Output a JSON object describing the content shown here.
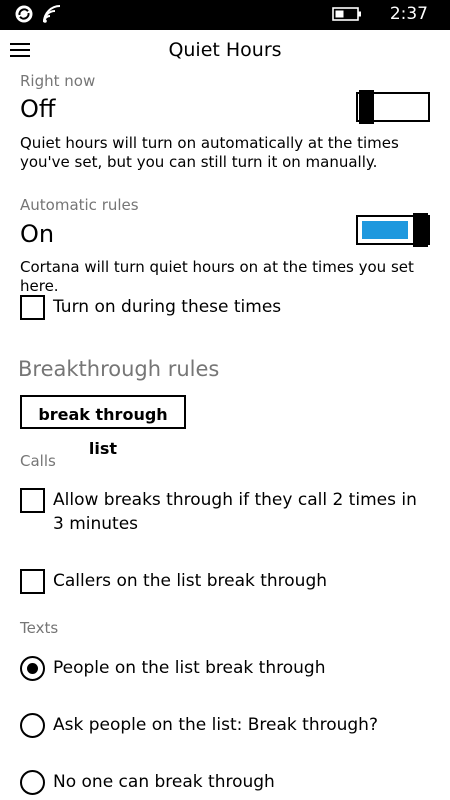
{
  "status_bar": {
    "time": "2:37",
    "icons": [
      "sync-icon",
      "wifi-icon",
      "battery-icon"
    ]
  },
  "header": {
    "title": "Quiet Hours",
    "menu_icon": "hamburger-menu-icon"
  },
  "right_now": {
    "label": "Right now",
    "value": "Off",
    "toggle_on": false,
    "description": "Quiet hours will turn on automatically at the times you've set, but you can still turn it on manually."
  },
  "automatic_rules": {
    "label": "Automatic rules",
    "value": "On",
    "toggle_on": true,
    "description": "Cortana will turn quiet hours on at the times you set here.",
    "checkbox": {
      "label": "Turn on during these times",
      "checked": false
    }
  },
  "breakthrough": {
    "title": "Breakthrough rules",
    "button_label": "break through list"
  },
  "calls": {
    "label": "Calls",
    "options": [
      {
        "label": "Allow breaks through if they call 2 times in 3 minutes",
        "checked": false
      },
      {
        "label": "Callers on the list break through",
        "checked": false
      }
    ]
  },
  "texts": {
    "label": "Texts",
    "options": [
      {
        "label": "People on the list break through",
        "selected": true
      },
      {
        "label": "Ask people on the list: Break through?",
        "selected": false
      },
      {
        "label": "No one can break through",
        "selected": false
      }
    ]
  },
  "colors": {
    "accent": "#1e98de",
    "status_bar": "#000000",
    "secondary_text": "#767676"
  }
}
